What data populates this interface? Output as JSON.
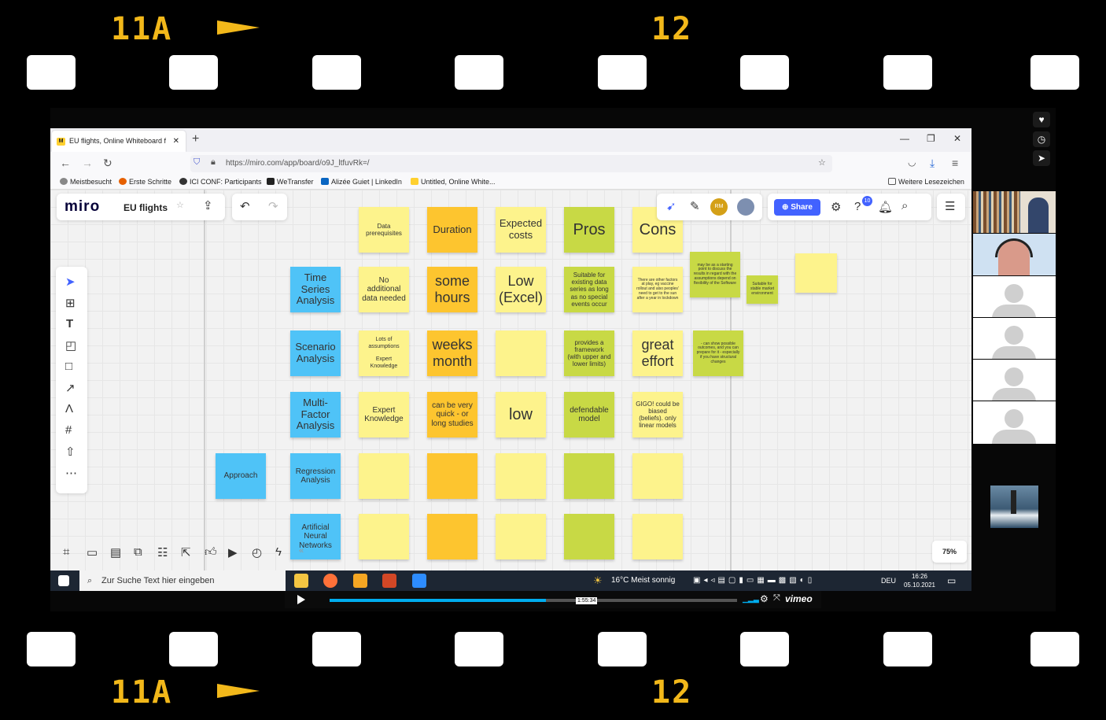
{
  "film": {
    "label_left": "11A",
    "label_right": "12"
  },
  "browser": {
    "tab_title": "EU flights, Online Whiteboard f",
    "url": "https://miro.com/app/board/o9J_ltfuvRk=/",
    "bookmarks": [
      "Meistbesucht",
      "Erste Schritte",
      "ICI CONF: Participants",
      "WeTransfer",
      "Alizée Guiet | LinkedIn",
      "Untitled, Online White..."
    ],
    "other_bookmarks": "Weitere Lesezeichen"
  },
  "miro": {
    "logo": "miro",
    "board_name": "EU flights",
    "share_label": "Share",
    "avatar_initials": "RM",
    "notification_count": "10",
    "zoom": "75%",
    "colors": {
      "blue": "#4fc3f7",
      "light_yellow": "#fdf38c",
      "orange": "#fdc52f",
      "green": "#c8d945",
      "share": "#4262ff"
    }
  },
  "board": {
    "headers": {
      "data": "Data prerequisites",
      "duration": "Duration",
      "costs": "Expected costs",
      "pros": "Pros",
      "cons": "Cons"
    },
    "approach": "Approach",
    "methods": [
      "Time Series Analysis",
      "Scenario Analysis",
      "Multi-Factor Analysis",
      "Regression Analysis",
      "Artificial Neural Networks"
    ],
    "row1": {
      "data": "No additional data needed",
      "duration": "some hours",
      "costs": "Low (Excel)",
      "pros": "Suitable for existing data series as long as no special events occur",
      "cons": "There are other factors at play, eg vaccine rollout and also peoples' need to get to the sun after a year in lockdown"
    },
    "row2": {
      "data_top": "Lots of assumptions",
      "data_bottom": "Expert Knowledge",
      "duration": "weeks month",
      "pros": "provides a framework (with upper and lower limits)",
      "cons": "great effort"
    },
    "row3": {
      "data": "Expert Knowledge",
      "duration": "can be very quick - or long studies",
      "costs": "low",
      "pros": "defendable model",
      "cons": "GIGO! could be biased (beliefs). only linear models"
    },
    "side_notes": {
      "note1": "may be as a starting point to discuss the results in regard with the assumptions depend on flexibility of the Software",
      "note2": "Suitable for stable market environment",
      "note3": "- can show possible outcomes, and you can prepare for it - especially if you have structural changes"
    }
  },
  "taskbar": {
    "search_placeholder": "Zur Suche Text hier eingeben",
    "weather": "16°C  Meist sonnig",
    "lang": "DEU",
    "time": "16:26",
    "date": "05.10.2021"
  },
  "vimeo": {
    "time": "1:55:34",
    "progress": 0.53,
    "brand": "vimeo"
  }
}
